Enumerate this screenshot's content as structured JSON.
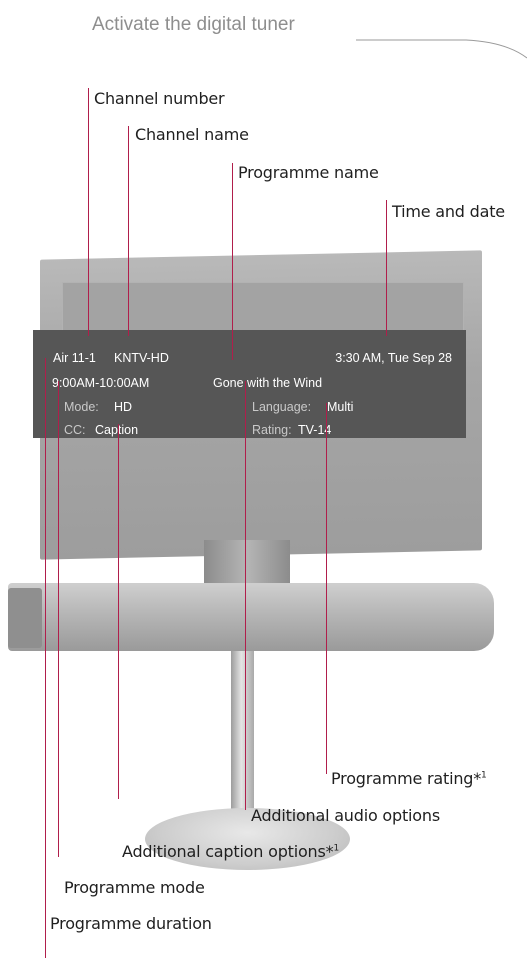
{
  "header": {
    "title": "Activate the digital tuner"
  },
  "osd": {
    "channel": "Air 11-1",
    "channel_name": "KNTV-HD",
    "datetime": "3:30 AM, Tue Sep 28",
    "duration": "9:00AM-10:00AM",
    "programme": "Gone with the Wind",
    "mode_label": "Mode:",
    "mode_value": "HD",
    "language_label": "Language:",
    "language_value": "Multi",
    "cc_label": "CC:",
    "cc_value": "Caption",
    "rating_label": "Rating:",
    "rating_value": "TV-14"
  },
  "callouts": {
    "channel_number": "Channel number",
    "channel_name": "Channel name",
    "programme_name": "Programme name",
    "time_and_date": "Time and date",
    "programme_rating": "Programme rating*",
    "programme_rating_sup": "1",
    "additional_audio": "Additional audio options",
    "additional_caption": "Additional caption options*",
    "additional_caption_sup": "1",
    "programme_mode": "Programme mode",
    "programme_duration": "Programme duration"
  },
  "colors": {
    "leader": "#b01e4b",
    "osd_background": "#565656",
    "header_text": "#8e8e8e"
  }
}
